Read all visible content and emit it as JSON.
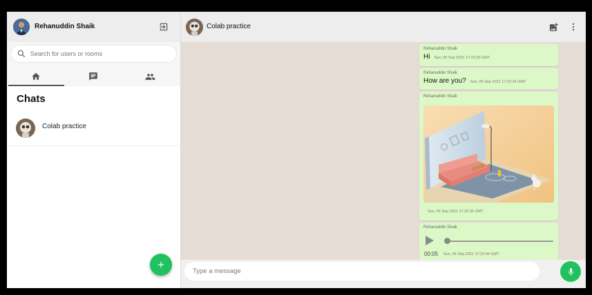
{
  "user": {
    "name": "Rehanuddin Shaik"
  },
  "search": {
    "placeholder": "Search for users or rooms"
  },
  "tabs": [
    {
      "icon": "home-icon",
      "active": true
    },
    {
      "icon": "chat-icon",
      "active": false
    },
    {
      "icon": "people-icon",
      "active": false
    }
  ],
  "sidebar": {
    "heading": "Chats",
    "chats": [
      {
        "name": "Colab practice"
      }
    ]
  },
  "room": {
    "name": "Colab practice"
  },
  "messages": [
    {
      "sender": "Rehanuddin Shaik",
      "text": "Hi",
      "time": "Sun, 05 Sep 2021 17:22:20 GMT"
    },
    {
      "sender": "Rehanuddin Shaik",
      "text": "How are you?",
      "time": "Sun, 05 Sep 2021 17:22:24 GMT"
    },
    {
      "sender": "Rehanuddin Shaik",
      "image": "living-room-3d-illustration",
      "time": "Sun, 05 Sep 2021 17:22:35 GMT"
    },
    {
      "sender": "Rehanuddin Shaik",
      "audio_duration": "00:05",
      "time": "Sun, 05 Sep 2021 17:22:44 GMT",
      "progress": 0
    }
  ],
  "composer": {
    "placeholder": "Type a message"
  },
  "colors": {
    "accent": "#21c160",
    "bubble": "#dcf8c6",
    "chat_bg": "#e5ddd5",
    "header_bg": "#ededed"
  }
}
